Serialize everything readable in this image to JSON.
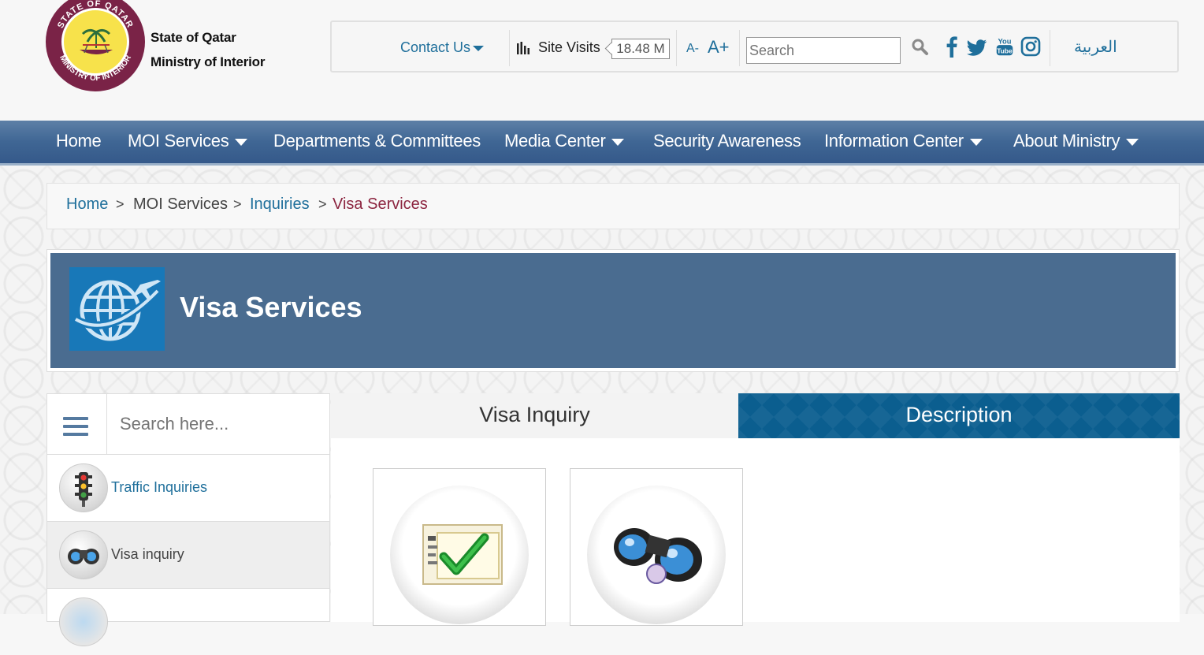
{
  "header": {
    "logo_text": "STATE OF QATAR · MINISTRY OF INTERIOR",
    "brand_line1": "State of Qatar",
    "brand_line2": "Ministry of Interior"
  },
  "topbar": {
    "contact_label": "Contact Us",
    "site_visits_label": "Site Visits",
    "site_visits_count": "18.48 M",
    "font_decrease": "A-",
    "font_increase": "A+",
    "search_placeholder": "Search",
    "social_icons": [
      "facebook-icon",
      "twitter-icon",
      "youtube-icon",
      "instagram-icon"
    ],
    "language": "العربية"
  },
  "nav": {
    "items": [
      {
        "label": "Home",
        "dropdown": false
      },
      {
        "label": "MOI Services",
        "dropdown": true
      },
      {
        "label": "Departments & Committees",
        "dropdown": false
      },
      {
        "label": "Media Center",
        "dropdown": true
      },
      {
        "label": "Security Awareness",
        "dropdown": false
      },
      {
        "label": "Information Center",
        "dropdown": true
      },
      {
        "label": "About Ministry",
        "dropdown": true
      }
    ]
  },
  "breadcrumb": {
    "items": [
      "Home",
      "MOI Services",
      "Inquiries",
      "Visa Services"
    ],
    "separator": ">"
  },
  "page": {
    "title": "Visa Services",
    "title_icon": "globe-plane-icon"
  },
  "sidebar": {
    "search_placeholder": "Search here...",
    "items": [
      {
        "label": "Traffic Inquiries",
        "icon": "traffic-light-icon",
        "selected": false
      },
      {
        "label": "Visa inquiry",
        "icon": "binoculars-icon",
        "selected": true
      }
    ]
  },
  "content": {
    "tabs": [
      {
        "label": "Visa Inquiry",
        "active": false
      },
      {
        "label": "Description",
        "active": true
      }
    ],
    "cards": [
      {
        "icon": "approved-document-icon"
      },
      {
        "icon": "binoculars-icon"
      }
    ]
  },
  "colors": {
    "link": "#1f6f9b",
    "nav_bg": "#3f6694",
    "title_bg": "#4a6c90",
    "active_crumb": "#8c2540",
    "active_tab": "#0b5e8f",
    "brand_maroon": "#7a2347"
  }
}
